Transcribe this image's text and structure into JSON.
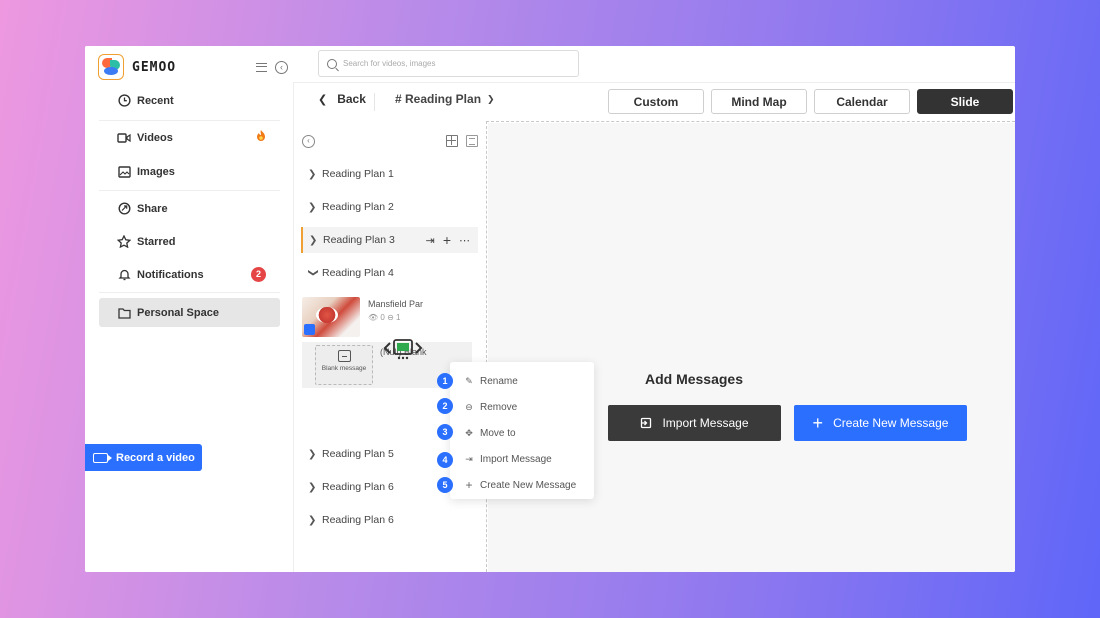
{
  "app": {
    "logo_text": "GEMOO"
  },
  "search": {
    "placeholder": "Search for videos, images"
  },
  "sidebar": {
    "items": [
      {
        "label": "Recent",
        "icon": "clock-icon"
      },
      {
        "label": "Videos",
        "icon": "video-icon",
        "extra_icon": "fire-icon"
      },
      {
        "label": "Images",
        "icon": "image-icon"
      },
      {
        "label": "Share",
        "icon": "share-icon"
      },
      {
        "label": "Starred",
        "icon": "star-icon"
      },
      {
        "label": "Notifications",
        "icon": "bell-icon",
        "badge": "2"
      },
      {
        "label": "Personal Space",
        "icon": "folder-icon",
        "active": true
      }
    ],
    "record_label": "Record a video"
  },
  "toolbar": {
    "back_label": "Back",
    "plan_label": "# Reading Plan",
    "tabs": [
      "Custom",
      "Mind Map",
      "Calendar",
      "Slide"
    ],
    "active_tab": "Slide"
  },
  "tree": {
    "plans": [
      "Reading Plan 1",
      "Reading Plan 2",
      "Reading Plan 3",
      "Reading Plan 4",
      "Reading Plan 5",
      "Reading Plan 6",
      "Reading Plan 6"
    ],
    "messages": [
      {
        "title": "Mansfield Par",
        "views": "0",
        "comments": "1"
      },
      {
        "title": "(Null) Blank",
        "thumb_label": "Blank message"
      }
    ]
  },
  "empty_state": {
    "title": "Add Messages",
    "import_label": "Import Message",
    "create_label": "Create New Message"
  },
  "context_menu": {
    "items": [
      {
        "step": "1",
        "label": "Rename",
        "icon": "edit-icon"
      },
      {
        "step": "2",
        "label": "Remove",
        "icon": "remove-icon"
      },
      {
        "step": "3",
        "label": "Move to",
        "icon": "move-icon"
      },
      {
        "step": "4",
        "label": "Import Message",
        "icon": "import-icon"
      },
      {
        "step": "5",
        "label": "Create New Message",
        "icon": "plus-icon"
      }
    ]
  },
  "colors": {
    "accent": "#2b6fff",
    "dark": "#333333",
    "badge": "#e54545",
    "highlight": "#f0a030"
  }
}
